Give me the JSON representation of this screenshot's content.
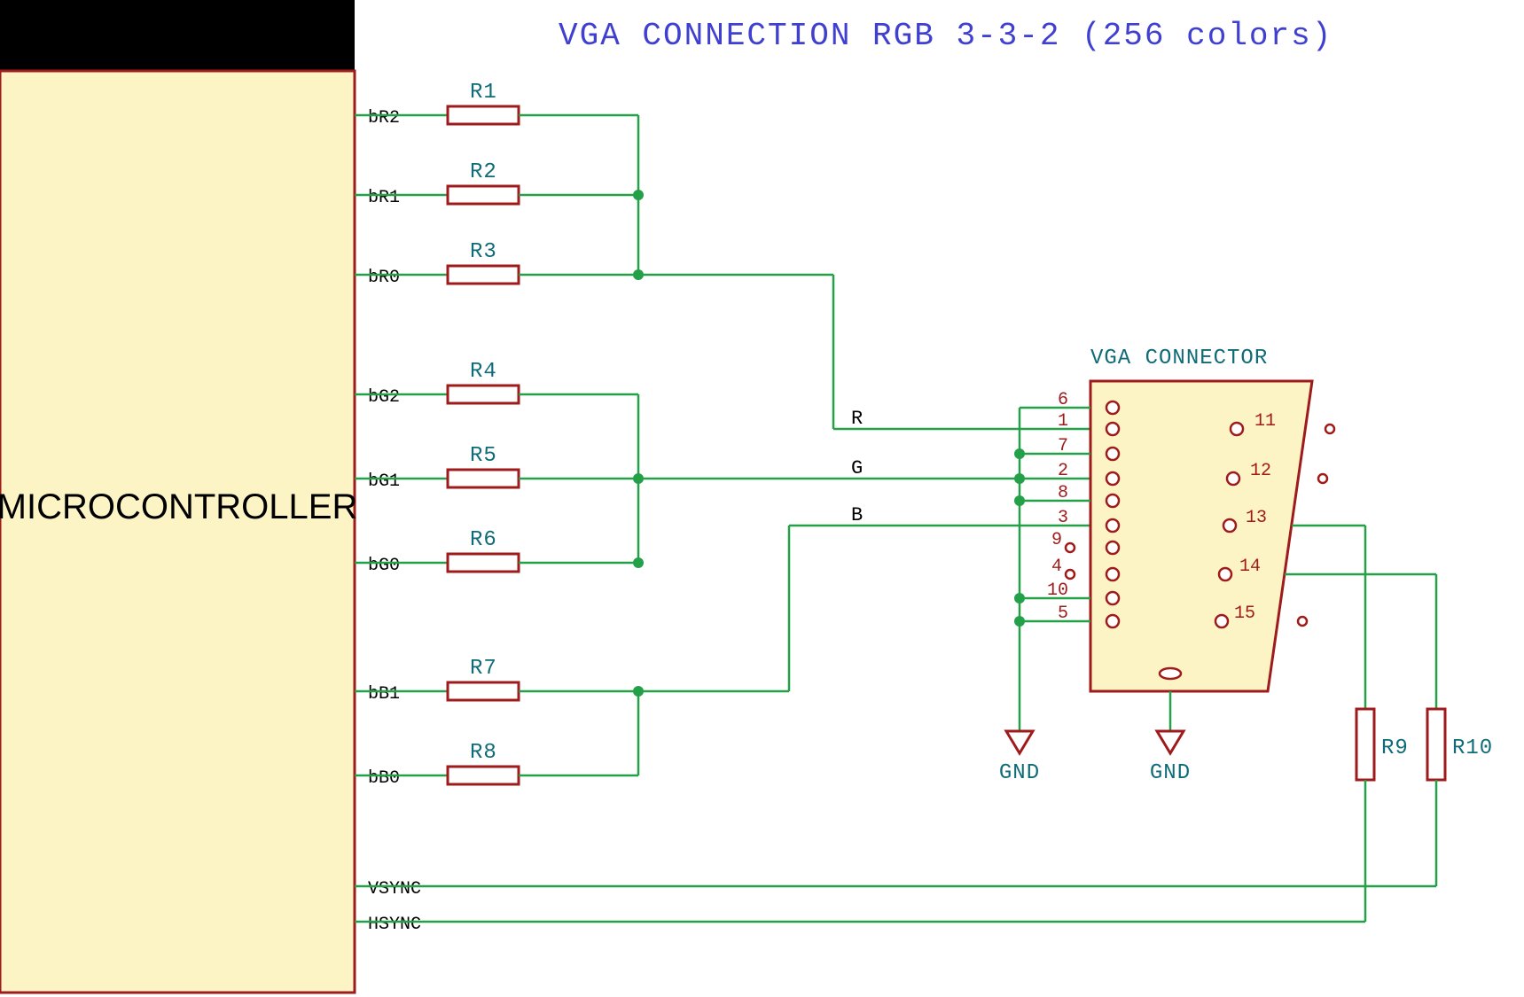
{
  "title": "VGA CONNECTION RGB 3-3-2 (256 colors)",
  "mcu": {
    "label": "MICROCONTROLLER"
  },
  "pins": {
    "bR2": "bR2",
    "bR1": "bR1",
    "bR0": "bR0",
    "bG2": "bG2",
    "bG1": "bG1",
    "bG0": "bG0",
    "bB1": "bB1",
    "bB0": "bB0",
    "VSYNC": "VSYNC",
    "HSYNC": "HSYNC"
  },
  "resistors": {
    "R1": "R1",
    "R2": "R2",
    "R3": "R3",
    "R4": "R4",
    "R5": "R5",
    "R6": "R6",
    "R7": "R7",
    "R8": "R8",
    "R9": "R9",
    "R10": "R10"
  },
  "nets": {
    "R": "R",
    "G": "G",
    "B": "B"
  },
  "connector": {
    "title": "VGA CONNECTOR",
    "pins": {
      "1": "1",
      "2": "2",
      "3": "3",
      "4": "4",
      "5": "5",
      "6": "6",
      "7": "7",
      "8": "8",
      "9": "9",
      "10": "10",
      "11": "11",
      "12": "12",
      "13": "13",
      "14": "14",
      "15": "15"
    }
  },
  "gnd": "GND"
}
